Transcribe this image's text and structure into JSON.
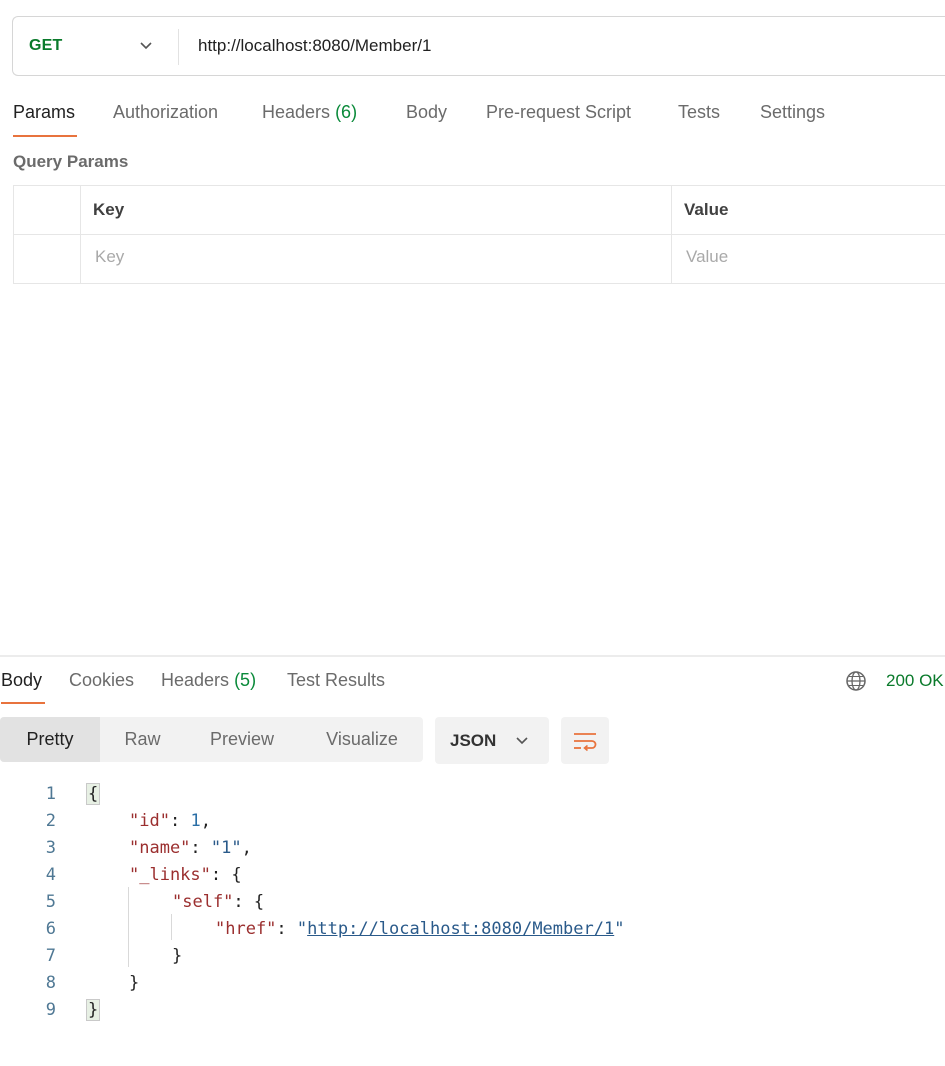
{
  "request": {
    "method": "GET",
    "url": "http://localhost:8080/Member/1"
  },
  "request_tabs": [
    {
      "label": "Params"
    },
    {
      "label": "Authorization"
    },
    {
      "label": "Headers",
      "count": "(6)"
    },
    {
      "label": "Body"
    },
    {
      "label": "Pre-request Script"
    },
    {
      "label": "Tests"
    },
    {
      "label": "Settings"
    }
  ],
  "query_params": {
    "title": "Query Params",
    "header_key": "Key",
    "header_value": "Value",
    "placeholder_key": "Key",
    "placeholder_value": "Value"
  },
  "response_tabs": [
    {
      "label": "Body"
    },
    {
      "label": "Cookies"
    },
    {
      "label": "Headers",
      "count": "(5)"
    },
    {
      "label": "Test Results"
    }
  ],
  "response_status": "200 OK",
  "view_modes": [
    "Pretty",
    "Raw",
    "Preview",
    "Visualize"
  ],
  "format": "JSON",
  "code_lines": {
    "numbers": [
      "1",
      "2",
      "3",
      "4",
      "5",
      "6",
      "7",
      "8",
      "9"
    ],
    "open_brace": "{",
    "close_brace": "}",
    "id_key": "\"id\"",
    "id_value": "1",
    "name_key": "\"name\"",
    "name_value": "\"1\"",
    "links_key": "\"_links\"",
    "self_key": "\"self\"",
    "href_key": "\"href\"",
    "href_value": "http://localhost:8080/Member/1"
  },
  "colors": {
    "accent": "#e8733d",
    "method_green": "#0a7a2b",
    "count_green": "#0a8a3a"
  }
}
